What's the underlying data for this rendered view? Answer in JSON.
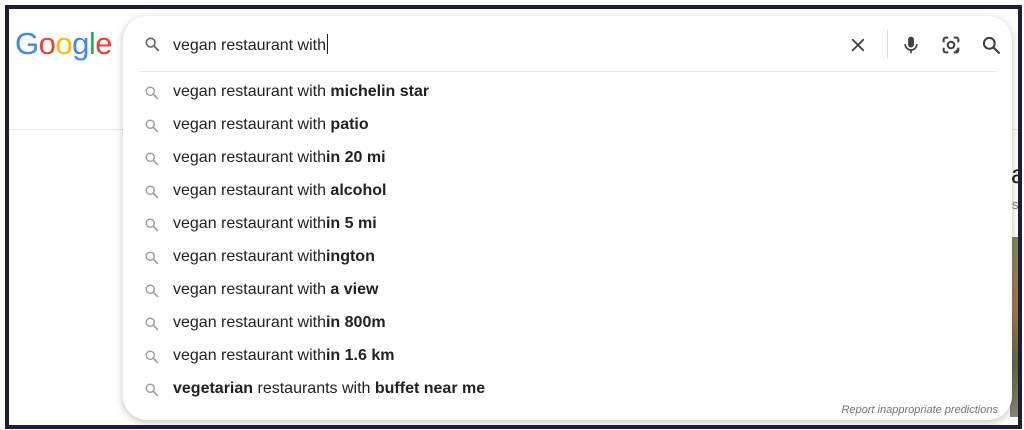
{
  "logo": {
    "text": "Google",
    "letters": [
      {
        "ch": "G",
        "color": "#4285F4"
      },
      {
        "ch": "o",
        "color": "#EA4335"
      },
      {
        "ch": "o",
        "color": "#FBBC05"
      },
      {
        "ch": "g",
        "color": "#4285F4"
      },
      {
        "ch": "l",
        "color": "#34A853"
      },
      {
        "ch": "e",
        "color": "#EA4335"
      }
    ]
  },
  "search": {
    "query": "vegan restaurant with",
    "icons": [
      "search-icon",
      "clear-icon",
      "mic-icon",
      "lens-icon",
      "search-submit-icon"
    ]
  },
  "suggestions": [
    {
      "prefix": "vegan restaurant with ",
      "bold": "michelin star",
      "suffix": ""
    },
    {
      "prefix": "vegan restaurant with ",
      "bold": "patio",
      "suffix": ""
    },
    {
      "prefix": "vegan restaurant with",
      "bold": "in 20 mi",
      "suffix": ""
    },
    {
      "prefix": "vegan restaurant with ",
      "bold": "alcohol",
      "suffix": ""
    },
    {
      "prefix": "vegan restaurant with",
      "bold": "in 5 mi",
      "suffix": ""
    },
    {
      "prefix": "vegan restaurant with",
      "bold": "ington",
      "suffix": ""
    },
    {
      "prefix": "vegan restaurant with ",
      "bold": "a view",
      "suffix": ""
    },
    {
      "prefix": "vegan restaurant with",
      "bold": "in 800m",
      "suffix": ""
    },
    {
      "prefix": "vegan restaurant with",
      "bold": "in 1.6 km",
      "suffix": ""
    },
    {
      "prefix": "",
      "bold": "vegetarian",
      "suffix": " restaurants with ",
      "bold2": "buffet near me"
    }
  ],
  "report_text": "Report inappropriate predictions",
  "colors": {
    "border": "#1f1c3a",
    "icon": "#5f6368",
    "text": "#202124"
  }
}
